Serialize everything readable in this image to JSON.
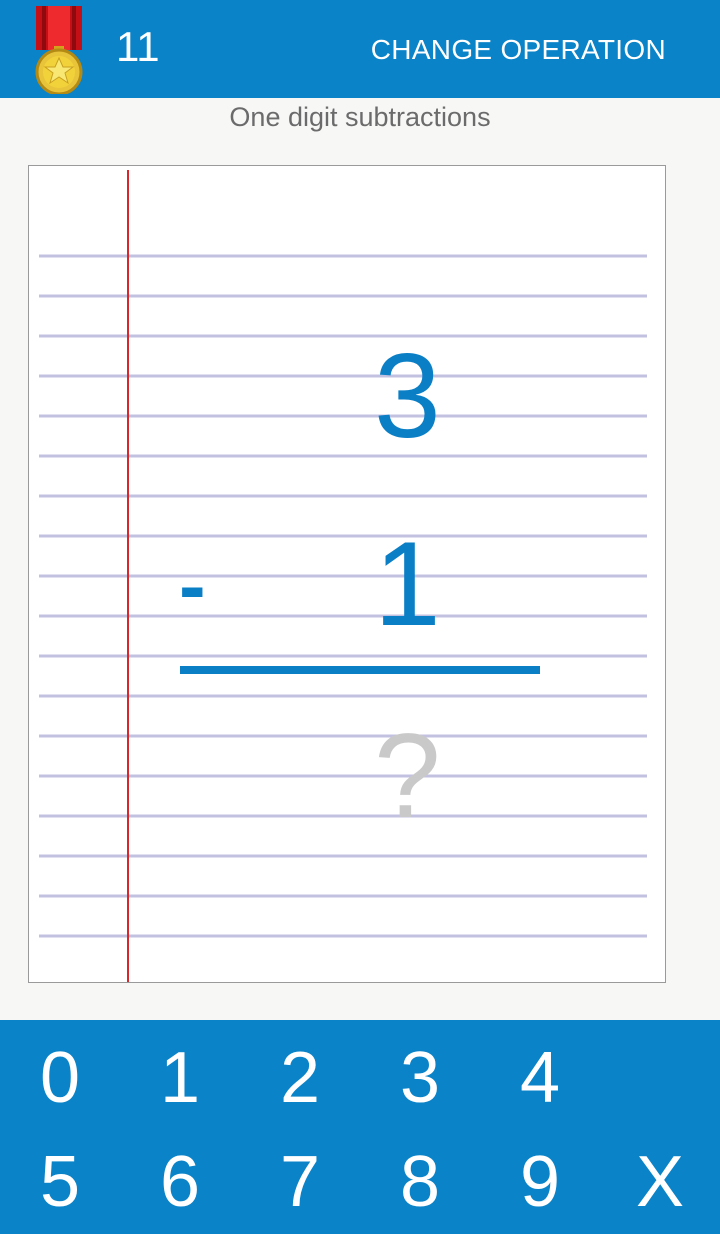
{
  "header": {
    "score": "11",
    "change_operation_label": "CHANGE OPERATION",
    "medal_icon": "medal-icon",
    "colors": {
      "bar": "#0a83c8",
      "medal_ribbon": "#e0141c",
      "medal_gold": "#f2d23a"
    }
  },
  "subtitle": "One digit subtractions",
  "problem": {
    "top_number": "3",
    "operator": "-",
    "bottom_number": "1",
    "answer_placeholder": "?"
  },
  "keypad": {
    "row1": [
      "0",
      "1",
      "2",
      "3",
      "4"
    ],
    "row2": [
      "5",
      "6",
      "7",
      "8",
      "9"
    ],
    "clear": "X"
  }
}
